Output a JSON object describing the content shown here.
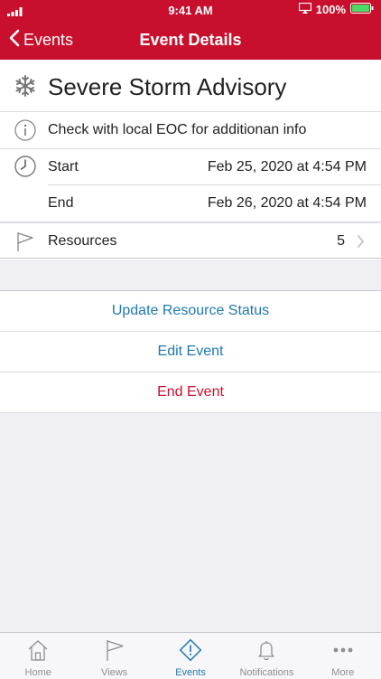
{
  "status": {
    "time": "9:41 AM",
    "battery": "100%"
  },
  "nav": {
    "back_label": "Events",
    "title": "Event Details"
  },
  "event": {
    "title": "Severe Storm Advisory",
    "info": "Check with local EOC for additionan info",
    "start_label": "Start",
    "start_value": "Feb 25, 2020 at 4:54 PM",
    "end_label": "End",
    "end_value": "Feb 26, 2020 at 4:54 PM",
    "resources_label": "Resources",
    "resources_count": "5"
  },
  "actions": {
    "update_status": "Update Resource Status",
    "edit": "Edit Event",
    "end": "End Event"
  },
  "tabs": [
    {
      "label": "Home",
      "icon": "home-icon"
    },
    {
      "label": "Views",
      "icon": "flag-icon"
    },
    {
      "label": "Events",
      "icon": "alert-icon"
    },
    {
      "label": "Notifications",
      "icon": "bell-icon"
    },
    {
      "label": "More",
      "icon": "more-icon"
    }
  ],
  "colors": {
    "brand": "#c8102e",
    "link": "#1f78b4",
    "danger": "#c8102e"
  }
}
